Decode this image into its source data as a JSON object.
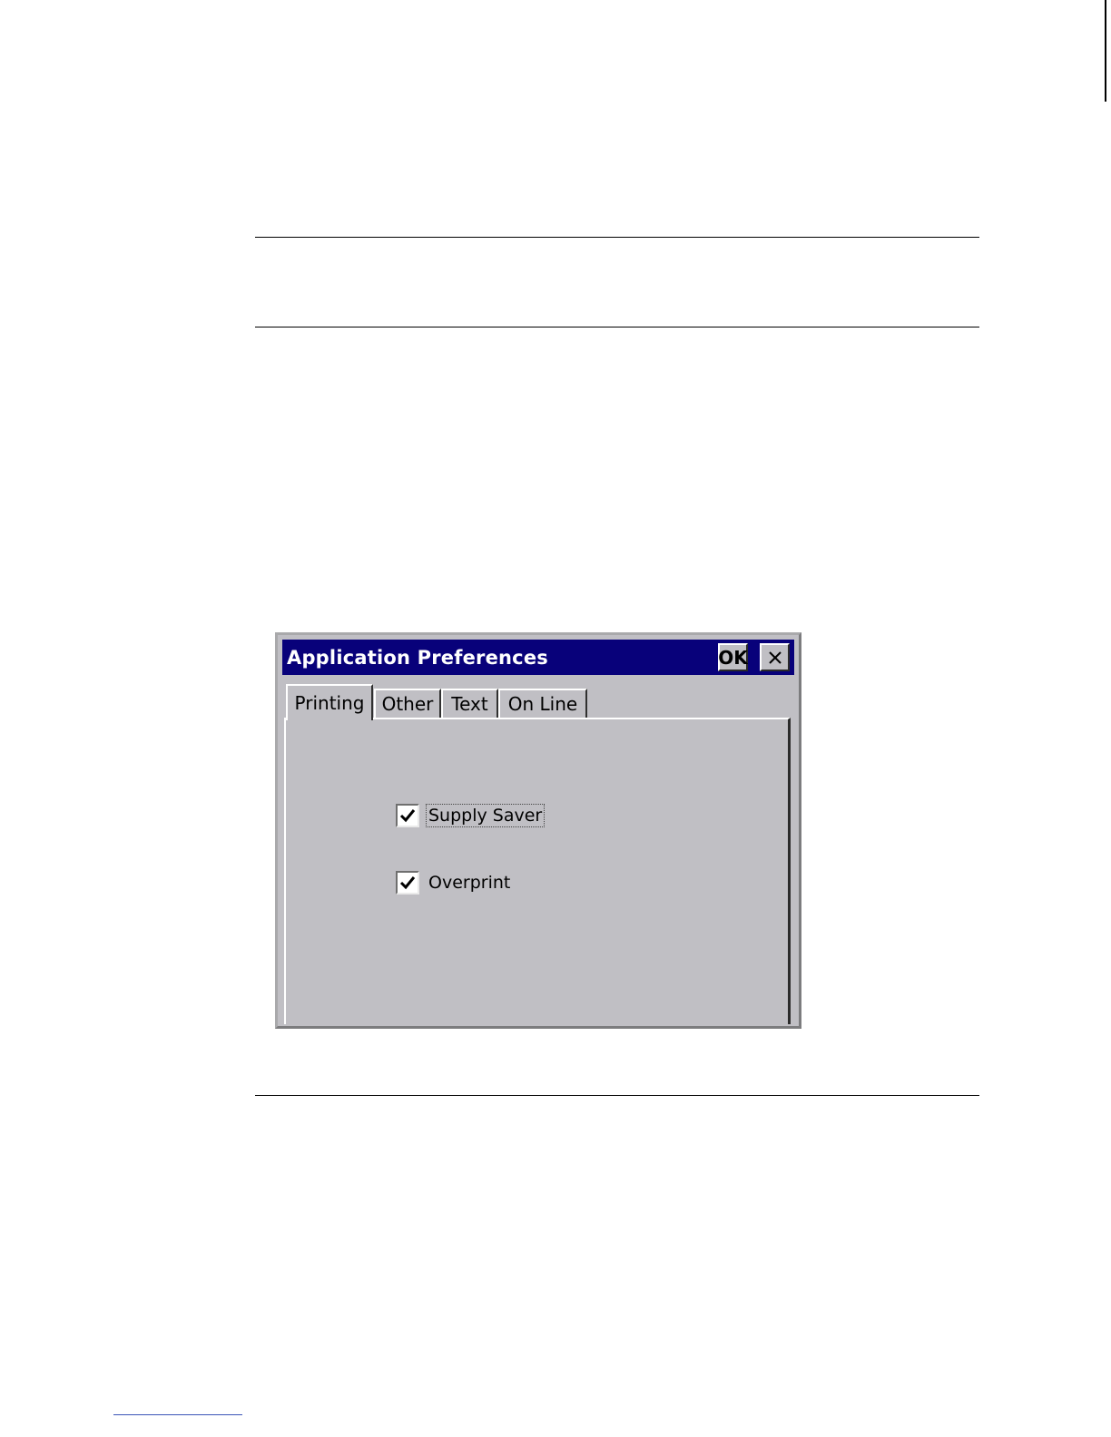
{
  "dialog": {
    "title": "Application Preferences",
    "ok_label": "OK",
    "close_icon": "close-icon",
    "tabs": [
      {
        "label": "Printing",
        "active": true
      },
      {
        "label": "Other",
        "active": false
      },
      {
        "label": "Text",
        "active": false
      },
      {
        "label": "On Line",
        "active": false
      }
    ],
    "options": [
      {
        "label": "Supply Saver",
        "checked": true,
        "focused": true
      },
      {
        "label": "Overprint",
        "checked": true,
        "focused": false
      }
    ]
  },
  "colors": {
    "titlebar": "#08017a",
    "dialog_face": "#c0bfc4",
    "page_background": "#ffffff"
  }
}
